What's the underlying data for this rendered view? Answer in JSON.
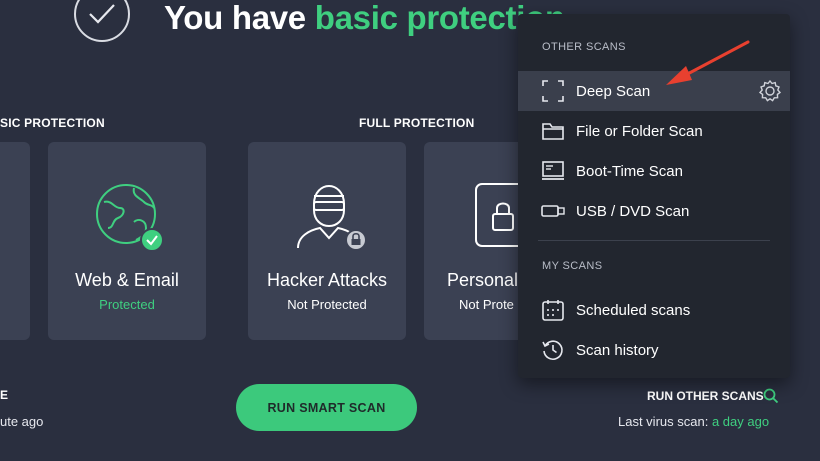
{
  "header": {
    "title_prefix": "You have ",
    "title_accent": "basic protection"
  },
  "sections": {
    "basic_label": "SIC PROTECTION",
    "full_label": "FULL PROTECTION"
  },
  "cards": [
    {
      "title": "Web & Email",
      "status": "Protected"
    },
    {
      "title": "Hacker Attacks",
      "status": "Not Protected"
    },
    {
      "title": "Personal",
      "status": "Not Prote"
    }
  ],
  "bottom": {
    "left_label": "E",
    "left_time": "ute ago",
    "run_button": "RUN SMART SCAN",
    "other_scans": "RUN OTHER SCANS",
    "last_scan_label": "Last virus scan:",
    "last_scan_value": "a day ago"
  },
  "menu": {
    "other_heading": "OTHER SCANS",
    "my_heading": "MY SCANS",
    "items": [
      {
        "label": "Deep Scan",
        "icon": "deep-scan-icon"
      },
      {
        "label": "File or Folder Scan",
        "icon": "folder-icon"
      },
      {
        "label": "Boot-Time Scan",
        "icon": "boot-time-icon"
      },
      {
        "label": "USB / DVD Scan",
        "icon": "usb-icon"
      }
    ],
    "my_items": [
      {
        "label": "Scheduled scans",
        "icon": "calendar-icon"
      },
      {
        "label": "Scan history",
        "icon": "history-icon"
      }
    ]
  },
  "colors": {
    "background": "#2a2f3f",
    "card": "#3b4153",
    "accent_green": "#3fcf80",
    "menu_bg": "#22262f",
    "menu_hover": "#3a3f4c",
    "arrow_red": "#e8402f"
  }
}
